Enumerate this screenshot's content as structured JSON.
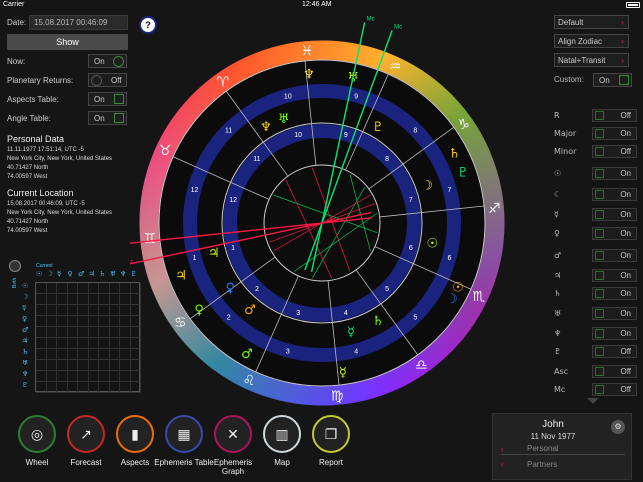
{
  "status": {
    "carrier": "Carrier",
    "time": "12:46 AM"
  },
  "left": {
    "date_label": "Date:",
    "date_value": "15.08.2017 00:46:09",
    "show_label": "Show",
    "now_label": "Now:",
    "now_value": "On",
    "planetary_returns_label": "Planetary Returns:",
    "planetary_returns_value": "Off",
    "aspects_table_label": "Aspects Table:",
    "aspects_table_value": "On",
    "angle_table_label": "Angle Table:",
    "angle_table_value": "On",
    "personal_title": "Personal Data",
    "personal_lines": [
      "11.11.1977 17:51:14, UTC -5",
      "New York City, New York, United States",
      "40.71427 North",
      "74.00597 West"
    ],
    "current_title": "Current Location",
    "current_lines": [
      "15.08.2017 00:46:09, UTC -5",
      "New York City, New York, United States",
      "40.71427 North",
      "74.00597 West"
    ],
    "grid_top_label": "Current",
    "grid_side_label": "Birth",
    "grid_cols": [
      "☉",
      "☽",
      "☿",
      "♀",
      "♂",
      "♃",
      "♄",
      "♅",
      "♆",
      "♇"
    ],
    "grid_rows": [
      "☉",
      "☽",
      "☿",
      "♀",
      "♂",
      "♃",
      "♄",
      "♅",
      "♆",
      "♇"
    ]
  },
  "help_label": "?",
  "chart": {
    "signs_outer": [
      "♓",
      "♒",
      "♑",
      "♐",
      "♏",
      "♎",
      "♍",
      "♌",
      "♋",
      "♊",
      "♉",
      "♈"
    ],
    "houses": [
      "1",
      "2",
      "3",
      "4",
      "5",
      "6",
      "7",
      "8",
      "9",
      "10",
      "11",
      "12"
    ],
    "angle_labels": [
      "Mc",
      "Mc",
      "Asc",
      "Asc"
    ],
    "planets_outer": [
      "♆",
      "♅",
      "♄",
      "♃",
      "♀",
      "♂",
      "☿",
      "☽",
      "☉",
      "♇"
    ],
    "planets_inner": [
      "♆",
      "♅",
      "♄",
      "♃",
      "♀",
      "♂",
      "☿",
      "☽",
      "☉",
      "♇"
    ]
  },
  "right": {
    "dropdowns": [
      "Default",
      "Align Zodiac",
      "Natal+Transit"
    ],
    "custom_label": "Custom:",
    "custom_value": "On",
    "rows": [
      {
        "label": "R",
        "value": "Off"
      },
      {
        "label": "Major",
        "value": "On"
      },
      {
        "label": "Minor",
        "value": "Off"
      },
      {
        "label": "☉",
        "value": "On"
      },
      {
        "label": "☾",
        "value": "On"
      },
      {
        "label": "☿",
        "value": "On"
      },
      {
        "label": "♀",
        "value": "On"
      },
      {
        "label": "♂",
        "value": "On"
      },
      {
        "label": "♃",
        "value": "On"
      },
      {
        "label": "♄",
        "value": "On"
      },
      {
        "label": "♅",
        "value": "On"
      },
      {
        "label": "♆",
        "value": "On"
      },
      {
        "label": "♇",
        "value": "Off"
      },
      {
        "label": "Asc",
        "value": "Off"
      },
      {
        "label": "Mc",
        "value": "Off"
      }
    ]
  },
  "profile": {
    "name": "John",
    "date": "11 Nov 1977",
    "personal": "Personal",
    "partners": "Partners"
  },
  "nav": [
    {
      "label": "Wheel",
      "icon": "wheel-icon",
      "color": "#2e7d32"
    },
    {
      "label": "Forecast",
      "icon": "forecast-icon",
      "color": "#c62828"
    },
    {
      "label": "Aspects",
      "icon": "aspects-icon",
      "color": "#ef6c00"
    },
    {
      "label": "Ephemeris Table",
      "icon": "ephemeris-table-icon",
      "color": "#3949ab"
    },
    {
      "label": "Ephemeris Graph",
      "icon": "ephemeris-graph-icon",
      "color": "#ad1457"
    },
    {
      "label": "Map",
      "icon": "map-icon",
      "color": "#cfd8dc"
    },
    {
      "label": "Report",
      "icon": "report-icon",
      "color": "#c0ca33"
    }
  ]
}
